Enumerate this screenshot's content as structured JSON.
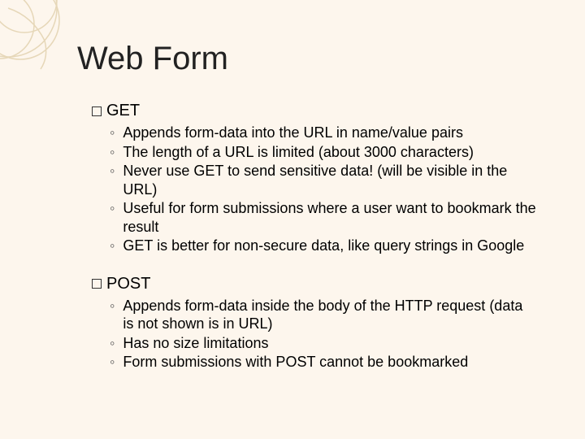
{
  "title": "Web Form",
  "sections": [
    {
      "label": "GET",
      "items": [
        "Appends form-data into the URL in name/value pairs",
        "The length of a URL is limited (about 3000 characters)",
        "Never use GET to send sensitive data! (will be visible in the URL)",
        "Useful for form submissions where a user want to bookmark the result",
        "GET is better for non-secure data, like query strings in Google"
      ]
    },
    {
      "label": "POST",
      "items": [
        "Appends form-data inside the body of the HTTP request (data is not shown is in URL)",
        "Has no size limitations",
        "Form submissions with POST cannot be bookmarked"
      ]
    }
  ]
}
